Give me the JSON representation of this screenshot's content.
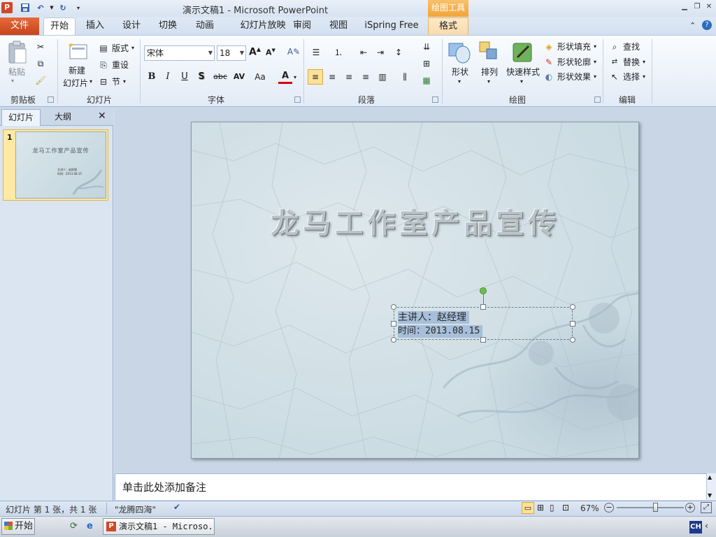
{
  "window": {
    "title": "演示文稿1 - Microsoft PowerPoint",
    "tools_tab": "绘图工具"
  },
  "tabs": [
    "文件",
    "开始",
    "插入",
    "设计",
    "切换",
    "动画",
    "幻灯片放映",
    "审阅",
    "视图",
    "iSpring Free",
    "格式"
  ],
  "ribbon": {
    "clipboard": {
      "paste": "粘贴",
      "label": "剪贴板"
    },
    "slides": {
      "new_slide_1": "新建",
      "new_slide_2": "幻灯片",
      "layout": "版式",
      "reset": "重设",
      "section": "节",
      "label": "幻灯片"
    },
    "font": {
      "font_name": "宋体",
      "font_size": "18",
      "bold": "B",
      "italic": "I",
      "underline": "U",
      "shadow": "S",
      "strike": "abc",
      "spacing": "AV",
      "case": "Aa",
      "color": "A",
      "grow": "A",
      "shrink": "A",
      "label": "字体"
    },
    "paragraph": {
      "label": "段落"
    },
    "drawing": {
      "shapes": "形状",
      "arrange": "排列",
      "quick_styles": "快速样式",
      "fill": "形状填充",
      "outline": "形状轮廓",
      "effects": "形状效果",
      "label": "绘图"
    },
    "editing": {
      "find": "查找",
      "replace": "替换",
      "select": "选择",
      "label": "编辑"
    }
  },
  "left_pane": {
    "tab_slides": "幻灯片",
    "tab_outline": "大纲",
    "close": "✕",
    "slide_number": "1",
    "thumb_title": "龙马工作室产品宣传",
    "thumb_sub1": "主讲人：赵经理",
    "thumb_sub2": "时间：2013.08.15"
  },
  "slide": {
    "title": "龙马工作室产品宣传",
    "subtitle_line1": "主讲人：赵经理",
    "subtitle_line2": "时间：2013.08.15"
  },
  "notes": {
    "placeholder": "单击此处添加备注"
  },
  "status": {
    "slide_info": "幻灯片 第 1 张，共 1 张",
    "theme": "\"龙腾四海\"",
    "zoom": "67%",
    "zoom_minus": "−",
    "zoom_plus": "+",
    "zoom_fraction": 0.58
  },
  "taskbar": {
    "start": "开始",
    "ppt_task": "演示文稿1 - Microso...",
    "ime": "CH"
  },
  "colors": {
    "file_tab": "#d24726",
    "tools_tab": "#f0a53a",
    "rotate_handle": "#6cc04a",
    "selection": "#a7bfd9"
  }
}
